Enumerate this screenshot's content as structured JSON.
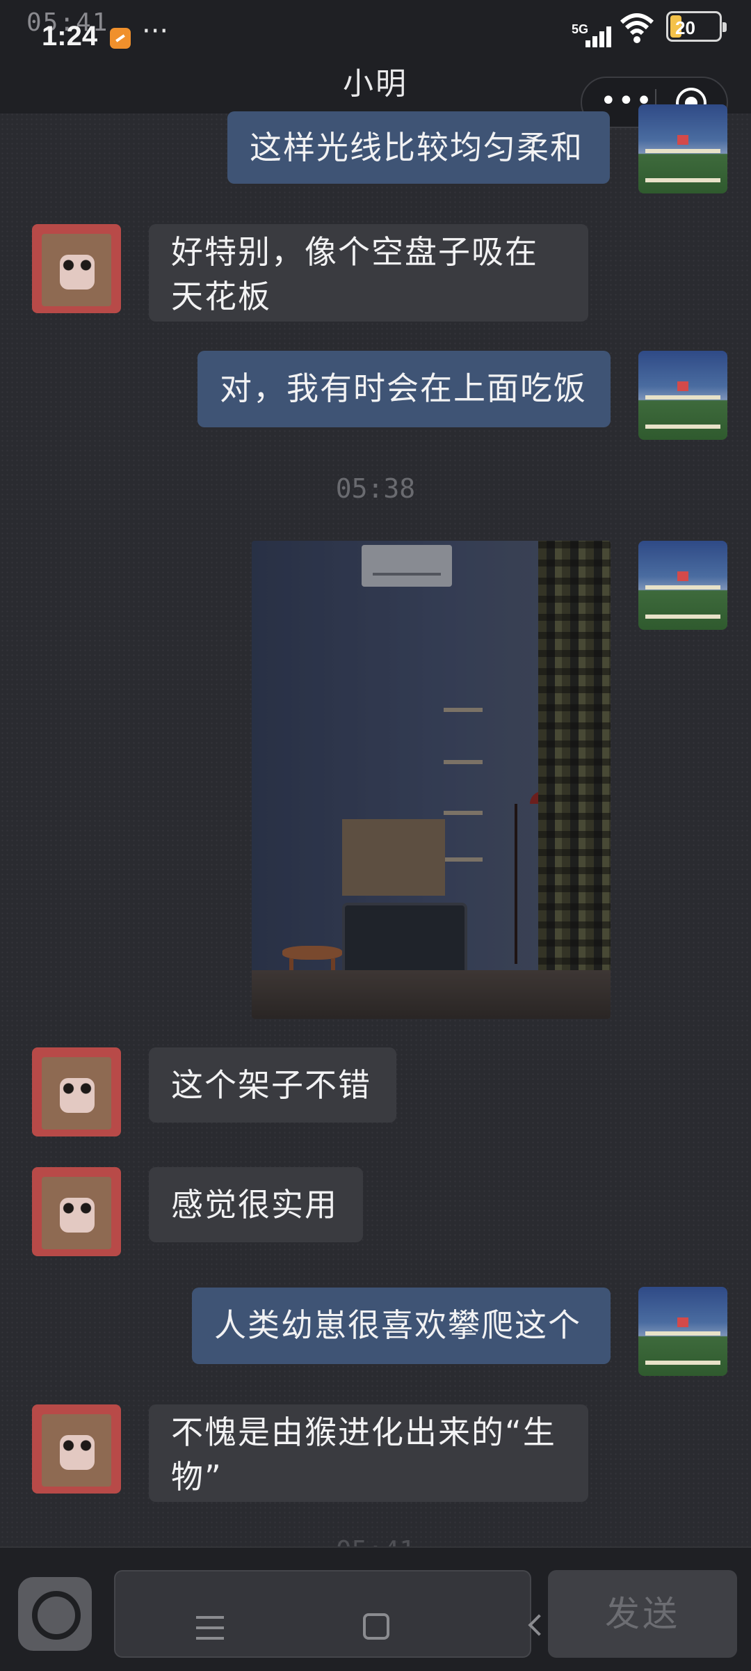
{
  "status_bar": {
    "time": "1:24",
    "ghost_time": "05:41",
    "more": "···",
    "network": "5G",
    "battery": "20"
  },
  "header": {
    "title": "小明",
    "more_icon": "more-dots-icon",
    "close_icon": "target-circle-icon"
  },
  "messages": [
    {
      "side": "out",
      "text": "这样光线比较均匀柔和"
    },
    {
      "side": "in",
      "text": "好特别，像个空盘子吸在天花板"
    },
    {
      "side": "out",
      "text": "对，我有时会在上面吃饭"
    },
    {
      "type": "timestamp",
      "text": "05:38"
    },
    {
      "side": "out",
      "type": "image",
      "icon": "room-photo"
    },
    {
      "side": "in",
      "text": "这个架子不错"
    },
    {
      "side": "in",
      "text": "感觉很实用"
    },
    {
      "side": "out",
      "text": "人类幼崽很喜欢攀爬这个"
    },
    {
      "side": "in",
      "text": "不愧是由猴进化出来的“生物”"
    }
  ],
  "peek_timestamp": "05:41",
  "input_bar": {
    "camera_icon": "camera-icon",
    "input_value": "",
    "send_label": "发送"
  },
  "nav": {
    "menu_icon": "menu-icon",
    "home_icon": "home-icon",
    "back_icon": "back-icon"
  },
  "colors": {
    "outgoing_bubble": "#3f5475",
    "incoming_bubble": "#3a3b40",
    "background": "#2a2b30"
  }
}
